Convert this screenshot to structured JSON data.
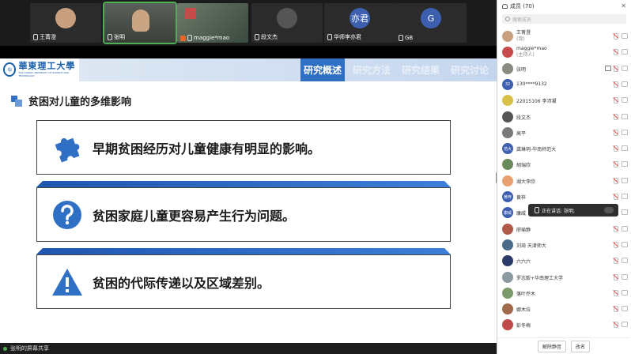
{
  "participants_strip": [
    {
      "name": "王菁澄",
      "kind": "avatar",
      "color": "#c8a080",
      "initial": ""
    },
    {
      "name": "张明",
      "kind": "video-face",
      "color": "",
      "initial": ""
    },
    {
      "name": "maggie*mao",
      "kind": "video-room",
      "color": "",
      "initial": ""
    },
    {
      "name": "段文杰",
      "kind": "avatar",
      "color": "#555555",
      "initial": ""
    },
    {
      "name": "华师李亦君",
      "kind": "avatar",
      "color": "#3d5fb0",
      "initial": "亦君"
    },
    {
      "name": "GB",
      "kind": "avatar",
      "color": "#3d5fb0",
      "initial": "G"
    }
  ],
  "slide": {
    "logo_cn": "華東理工大學",
    "logo_en": "EAST CHINA UNIVERSITY OF SCIENCE AND TECHNOLOGY",
    "tabs": [
      "研究概述",
      "研究方法",
      "研究结果",
      "研究讨论"
    ],
    "active_tab": "研究概述",
    "section_title": "贫困对儿童的多维影响",
    "cards": [
      {
        "icon": "puzzle-icon",
        "text": "早期贫困经历对儿童健康有明显的影响。"
      },
      {
        "icon": "question-icon",
        "text": "贫困家庭儿童更容易产生行为问题。"
      },
      {
        "icon": "warning-icon",
        "text": "贫困的代际传递以及区域差别。"
      }
    ],
    "accent": "#2f6fc4"
  },
  "share_bar": {
    "text": "张明的屏幕共享"
  },
  "panel": {
    "title": "成员 (70)",
    "search_placeholder": "搜索成员",
    "members": [
      {
        "name": "王菁澄",
        "sub": "(我)",
        "color": "#c8a080",
        "initial": "",
        "screen": false
      },
      {
        "name": "maggie*mao",
        "sub": "(主持人)",
        "color": "#c94a4a",
        "initial": "",
        "screen": false
      },
      {
        "name": "张明",
        "sub": "",
        "color": "#8a8a80",
        "initial": "",
        "screen": true
      },
      {
        "name": "130****9132",
        "sub": "",
        "color": "#3d5fb0",
        "initial": "32",
        "screen": false
      },
      {
        "name": "22015106 李沛凝",
        "sub": "",
        "color": "#d9c04a",
        "initial": "",
        "screen": false
      },
      {
        "name": "段文杰",
        "sub": "",
        "color": "#555555",
        "initial": "",
        "screen": false
      },
      {
        "name": "高平",
        "sub": "",
        "color": "#7a7a7a",
        "initial": "",
        "screen": false
      },
      {
        "name": "龚琳玥-华南师范大",
        "sub": "",
        "color": "#3d5fb0",
        "initial": "范大",
        "screen": false
      },
      {
        "name": "胡瑞欣",
        "sub": "",
        "color": "#6a8a5a",
        "initial": "",
        "screen": false
      },
      {
        "name": "湖大李欣",
        "sub": "",
        "color": "#e8a070",
        "initial": "",
        "screen": false
      },
      {
        "name": "黄梓",
        "sub": "",
        "color": "#3d5fb0",
        "initial": "黄梓",
        "screen": false
      },
      {
        "name": "康威",
        "sub": "",
        "color": "#3d5fb0",
        "initial": "康威",
        "screen": false
      },
      {
        "name": "廖瑜静",
        "sub": "",
        "color": "#b05a4a",
        "initial": "",
        "screen": false
      },
      {
        "name": "刘琦 天津师大",
        "sub": "",
        "color": "#4a6a8a",
        "initial": "",
        "screen": false
      },
      {
        "name": "六六六",
        "sub": "",
        "color": "#2a3a6a",
        "initial": "",
        "screen": false
      },
      {
        "name": "罗志毅+华南理工大学",
        "sub": "",
        "color": "#8a9aa0",
        "initial": "",
        "screen": false
      },
      {
        "name": "落叶乔木",
        "sub": "",
        "color": "#7a9a6a",
        "initial": "",
        "screen": false
      },
      {
        "name": "娜木拉",
        "sub": "",
        "color": "#a06a4a",
        "initial": "",
        "screen": false
      },
      {
        "name": "彭冬梅",
        "sub": "",
        "color": "#c04a4a",
        "initial": "",
        "screen": false
      }
    ],
    "speaking_text": "正在讲话: 张明;",
    "footer_buttons": [
      "解除静音",
      "改名"
    ]
  }
}
